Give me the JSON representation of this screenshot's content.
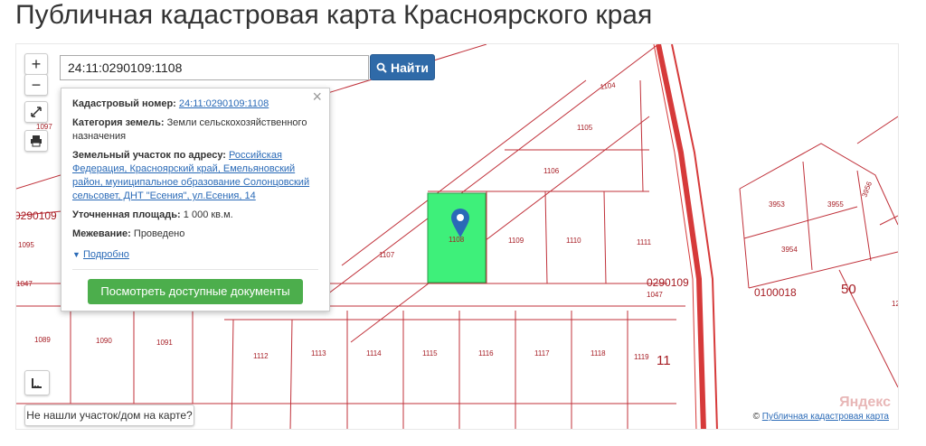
{
  "page": {
    "title": "Публичная кадастровая карта Красноярского края"
  },
  "search": {
    "value": "24:11:0290109:1108",
    "button_label": "Найти"
  },
  "controls": {
    "zoom_in": "+",
    "zoom_out": "−"
  },
  "popup": {
    "cadastral_number_label": "Кадастровый номер:",
    "cadastral_number_value": "24:11:0290109:1108",
    "land_category_label": "Категория земель:",
    "land_category_value": "Земли сельскохозяйственного назначения",
    "address_label": "Земельный участок по адресу:",
    "address_value": "Российская Федерация, Красноярский край, Емельяновский район, муниципальное образование Солонцовский сельсовет, ДНТ \"Есения\", ул.Есения, 14",
    "area_label": "Уточненная площадь:",
    "area_value": "1 000 кв.м.",
    "survey_label": "Межевание:",
    "survey_value": "Проведено",
    "more_label": "Подробно",
    "docs_button": "Посмотреть доступные документы",
    "close": "×"
  },
  "not_found_button": "Не нашли участок/дом на карте?",
  "attribution": {
    "prefix": "©",
    "link": "Публичная кадастровая карта",
    "provider": "Яндекс"
  },
  "parcels": {
    "p1104": "1104",
    "p1105": "1105",
    "p1106": "1106",
    "p1107": "1107",
    "p1108": "1108",
    "p1109": "1109",
    "p1110": "1110",
    "p1111": "1111",
    "p1112": "1112",
    "p1113": "1113",
    "p1114": "1114",
    "p1115": "1115",
    "p1116": "1116",
    "p1117": "1117",
    "p1118": "1118",
    "p1119": "1119",
    "p1089": "1089",
    "p1090": "1090",
    "p1091": "1091",
    "p1095": "1095",
    "p1097": "1097",
    "p1047a": "1047",
    "p1047b": "1047",
    "p3953": "3953",
    "p3955": "3955",
    "p3956": "3956",
    "p3954": "3954",
    "q0290109a": "0290109",
    "q0290109b": "0290109",
    "q0100018": "0100018",
    "n50": "50",
    "n11": "11",
    "n12": "12"
  },
  "colors": {
    "boundary": "#c0313a",
    "selected_fill": "#3ef07a",
    "marker": "#2a6ab7",
    "search_button": "#2f6aa8",
    "docs_button": "#4cae4c"
  }
}
